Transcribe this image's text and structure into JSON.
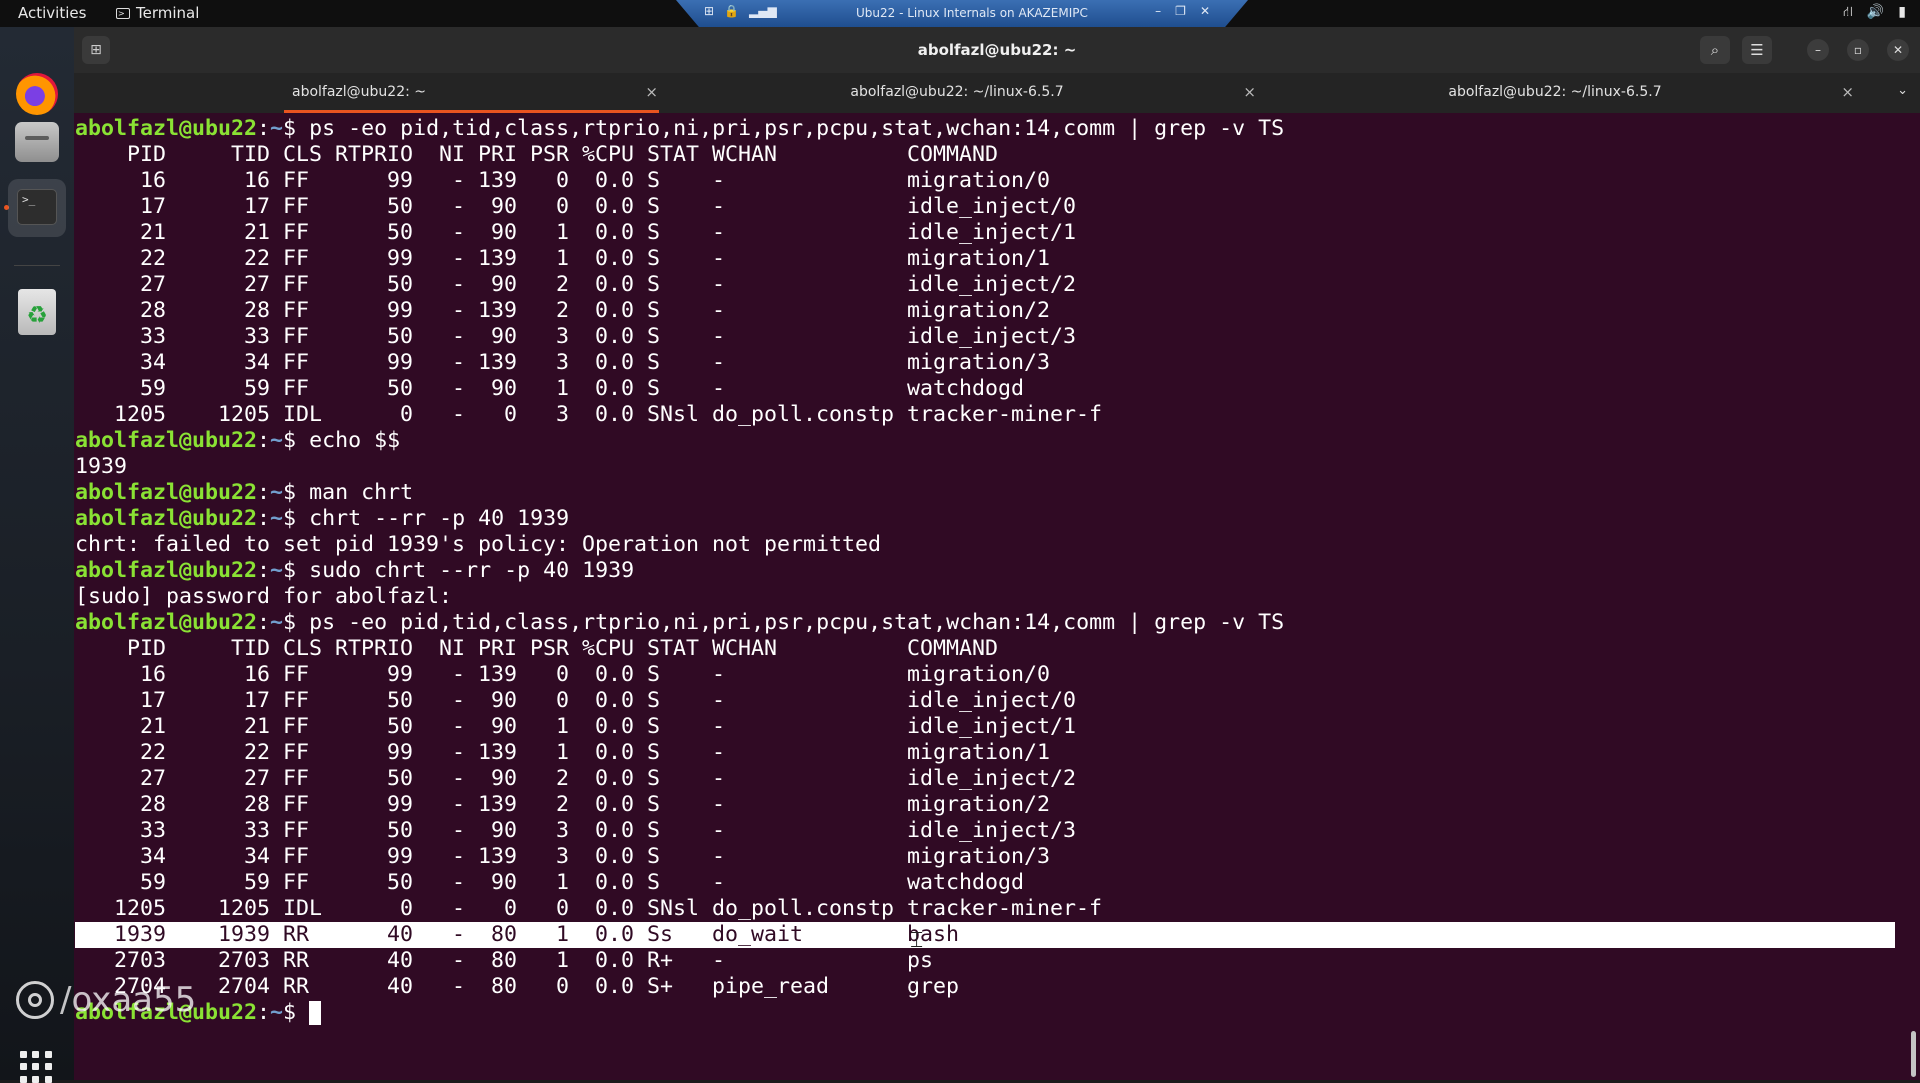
{
  "topbar": {
    "activities": "Activities",
    "app_name": "Terminal"
  },
  "remote_bar": {
    "title": "Ubu22 - Linux Internals on AKAZEMIPC"
  },
  "window": {
    "title": "abolfazl@ubu22: ~"
  },
  "tabs": [
    {
      "label": "abolfazl@ubu22: ~",
      "active": true
    },
    {
      "label": "abolfazl@ubu22: ~/linux-6.5.7",
      "active": false
    },
    {
      "label": "abolfazl@ubu22: ~/linux-6.5.7",
      "active": false
    }
  ],
  "prompt": {
    "user": "abolfazl@ubu22",
    "sep": ":",
    "path": "~",
    "dollar": "$ "
  },
  "terminal_lines": [
    {
      "type": "cmd",
      "cmd": "ps -eo pid,tid,class,rtprio,ni,pri,psr,pcpu,stat,wchan:14,comm | grep -v TS"
    },
    {
      "type": "out",
      "text": "    PID     TID CLS RTPRIO  NI PRI PSR %CPU STAT WCHAN          COMMAND"
    },
    {
      "type": "out",
      "text": "     16      16 FF      99   - 139   0  0.0 S    -              migration/0"
    },
    {
      "type": "out",
      "text": "     17      17 FF      50   -  90   0  0.0 S    -              idle_inject/0"
    },
    {
      "type": "out",
      "text": "     21      21 FF      50   -  90   1  0.0 S    -              idle_inject/1"
    },
    {
      "type": "out",
      "text": "     22      22 FF      99   - 139   1  0.0 S    -              migration/1"
    },
    {
      "type": "out",
      "text": "     27      27 FF      50   -  90   2  0.0 S    -              idle_inject/2"
    },
    {
      "type": "out",
      "text": "     28      28 FF      99   - 139   2  0.0 S    -              migration/2"
    },
    {
      "type": "out",
      "text": "     33      33 FF      50   -  90   3  0.0 S    -              idle_inject/3"
    },
    {
      "type": "out",
      "text": "     34      34 FF      99   - 139   3  0.0 S    -              migration/3"
    },
    {
      "type": "out",
      "text": "     59      59 FF      50   -  90   1  0.0 S    -              watchdogd"
    },
    {
      "type": "out",
      "text": "   1205    1205 IDL      0   -   0   3  0.0 SNsl do_poll.constp tracker-miner-f"
    },
    {
      "type": "cmd",
      "cmd": "echo $$"
    },
    {
      "type": "out",
      "text": "1939"
    },
    {
      "type": "cmd",
      "cmd": "man chrt"
    },
    {
      "type": "cmd",
      "cmd": "chrt --rr -p 40 1939"
    },
    {
      "type": "out",
      "text": "chrt: failed to set pid 1939's policy: Operation not permitted"
    },
    {
      "type": "cmd",
      "cmd": "sudo chrt --rr -p 40 1939"
    },
    {
      "type": "out",
      "text": "[sudo] password for abolfazl:"
    },
    {
      "type": "cmd",
      "cmd": "ps -eo pid,tid,class,rtprio,ni,pri,psr,pcpu,stat,wchan:14,comm | grep -v TS"
    },
    {
      "type": "out",
      "text": "    PID     TID CLS RTPRIO  NI PRI PSR %CPU STAT WCHAN          COMMAND"
    },
    {
      "type": "out",
      "text": "     16      16 FF      99   - 139   0  0.0 S    -              migration/0"
    },
    {
      "type": "out",
      "text": "     17      17 FF      50   -  90   0  0.0 S    -              idle_inject/0"
    },
    {
      "type": "out",
      "text": "     21      21 FF      50   -  90   1  0.0 S    -              idle_inject/1"
    },
    {
      "type": "out",
      "text": "     22      22 FF      99   - 139   1  0.0 S    -              migration/1"
    },
    {
      "type": "out",
      "text": "     27      27 FF      50   -  90   2  0.0 S    -              idle_inject/2"
    },
    {
      "type": "out",
      "text": "     28      28 FF      99   - 139   2  0.0 S    -              migration/2"
    },
    {
      "type": "out",
      "text": "     33      33 FF      50   -  90   3  0.0 S    -              idle_inject/3"
    },
    {
      "type": "out",
      "text": "     34      34 FF      99   - 139   3  0.0 S    -              migration/3"
    },
    {
      "type": "out",
      "text": "     59      59 FF      50   -  90   1  0.0 S    -              watchdogd"
    },
    {
      "type": "out",
      "text": "   1205    1205 IDL      0   -   0   0  0.0 SNsl do_poll.constp tracker-miner-f"
    },
    {
      "type": "out",
      "text": "   1939    1939 RR      40   -  80   1  0.0 Ss   do_wait        bash",
      "highlight": true
    },
    {
      "type": "out",
      "text": "   2703    2703 RR      40   -  80   1  0.0 R+   -              ps"
    },
    {
      "type": "out",
      "text": "   2704    2704 RR      40   -  80   0  0.0 S+   pipe_read      grep"
    },
    {
      "type": "cmd",
      "cmd": "",
      "cursor": true
    }
  ],
  "watermark": "/oxaa55",
  "colors": {
    "terminal_bg": "#300a24",
    "prompt_user": "#8ae234",
    "prompt_path": "#729fcf",
    "tab_accent": "#e95420"
  }
}
